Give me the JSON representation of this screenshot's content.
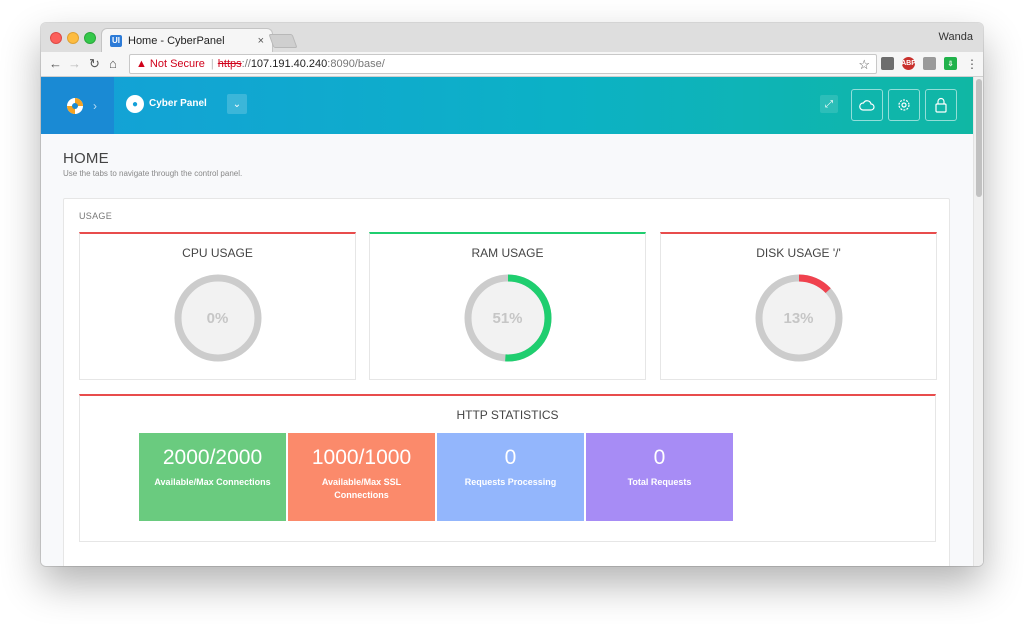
{
  "browser": {
    "tab_title": "Home - CyberPanel",
    "tab_favicon": "UI",
    "tab_close": "×",
    "profile_name": "Wanda",
    "not_secure": "Not Secure",
    "url_scheme": "https",
    "url_sep": "://",
    "url_host": "107.191.40.240",
    "url_path": ":8090/base/",
    "extensions": [
      "pocket-icon",
      "adblock-icon",
      "reader-icon",
      "download-icon"
    ],
    "ext2_label": "ABP"
  },
  "header": {
    "brand_logo": "cyberpanel-logo",
    "user_name": "Cyber Panel",
    "icons": [
      "expand-icon",
      "cloud-icon",
      "gear-icon",
      "lock-icon"
    ]
  },
  "page": {
    "title": "HOME",
    "subtitle": "Use the tabs to navigate through the control panel."
  },
  "usage": {
    "label": "USAGE",
    "gauges": [
      {
        "title": "CPU USAGE",
        "percent": 0,
        "value_label": "0%",
        "color": "#e84c4c"
      },
      {
        "title": "RAM USAGE",
        "percent": 51,
        "value_label": "51%",
        "color": "#1fce6f"
      },
      {
        "title": "DISK USAGE '/'",
        "percent": 13,
        "value_label": "13%",
        "color": "#f0424e"
      }
    ]
  },
  "http": {
    "title": "HTTP STATISTICS",
    "stats": [
      {
        "value": "2000/2000",
        "label": "Available/Max Connections",
        "color": "#6acb7f"
      },
      {
        "value": "1000/1000",
        "label": "Available/Max SSL Connections",
        "color": "#fb8a6b"
      },
      {
        "value": "0",
        "label": "Requests Processing",
        "color": "#93b6fc"
      },
      {
        "value": "0",
        "label": "Total Requests",
        "color": "#a78cf5"
      }
    ]
  }
}
